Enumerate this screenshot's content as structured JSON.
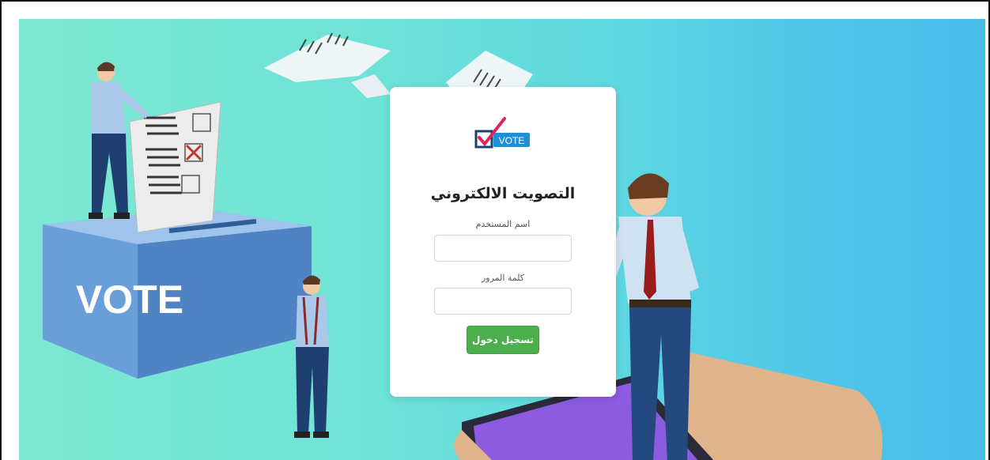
{
  "illustration": {
    "ballot_box_text": "VOTE"
  },
  "login": {
    "logo_text": "VOTE",
    "title": "التصويت الالكتروني",
    "username_label": "اسم المستخدم",
    "username_value": "",
    "password_label": "كلمة المرور",
    "password_value": "",
    "submit_label": "تسجيل دخول"
  },
  "colors": {
    "submit_button": "#4cae4c",
    "background_start": "#7de8d2",
    "background_end": "#49bdea",
    "logo_blue": "#1e90d8",
    "logo_check": "#e0245e"
  }
}
